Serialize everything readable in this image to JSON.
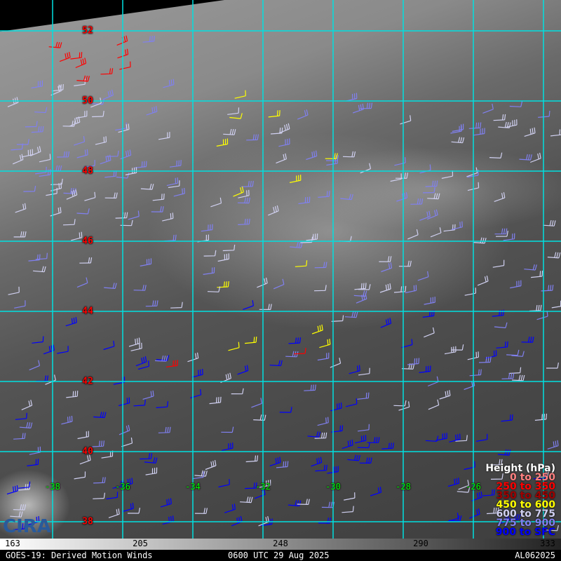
{
  "colors": {
    "grid": "#00e0e0",
    "lat": "#ff0000",
    "lon": "#00ff00"
  },
  "latitudes": [
    "52",
    "50",
    "48",
    "46",
    "44",
    "42",
    "40",
    "38"
  ],
  "longitudes": [
    "-38",
    "-36",
    "-34",
    "-32",
    "-30",
    "-28",
    "-26"
  ],
  "legend": {
    "title": "Height (hPa)",
    "items": [
      {
        "label": "0 to 250",
        "color": "#ff8080"
      },
      {
        "label": "250 to 350",
        "color": "#ff0000"
      },
      {
        "label": "350 to 450",
        "color": "#a00000"
      },
      {
        "label": "450 to 600",
        "color": "#ffff00"
      },
      {
        "label": "600 to 775",
        "color": "#d0d0f0"
      },
      {
        "label": "775 to 900",
        "color": "#8080f0"
      },
      {
        "label": "900 to SFC",
        "color": "#0000ff"
      }
    ]
  },
  "colorbar": {
    "ticks": [
      "163",
      "205",
      "248",
      "290",
      "333"
    ]
  },
  "logo": "CIRA",
  "footer": {
    "left": "GOES-19: Derived Motion Winds",
    "center": "0600 UTC 29 Aug 2025",
    "right": "AL062025"
  }
}
